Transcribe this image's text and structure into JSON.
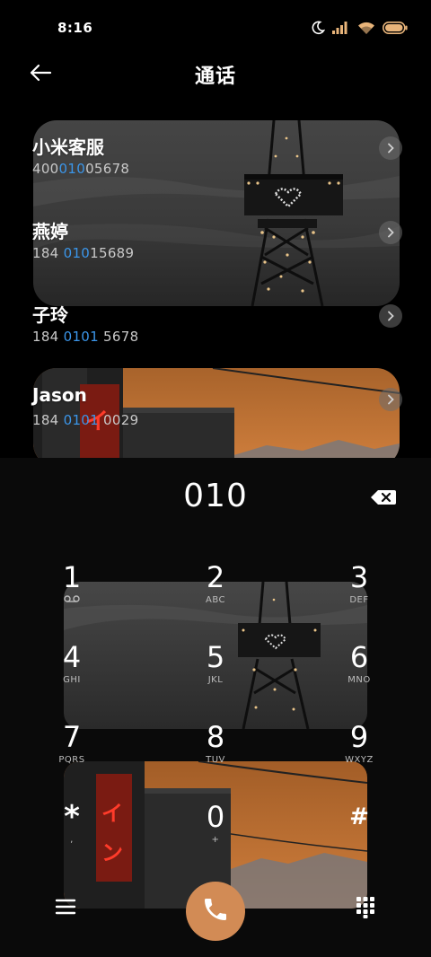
{
  "status_bar": {
    "time": "8:16",
    "icons": [
      "moon-icon",
      "signal-icon",
      "wifi-icon",
      "battery-icon"
    ],
    "battery_color": "#e8b47a"
  },
  "header": {
    "back_icon": "arrow-left-icon",
    "title": "通话"
  },
  "contacts": [
    {
      "name": "小米客服",
      "number_before": "400",
      "number_match": "010",
      "number_after": "05678"
    },
    {
      "name": "燕婷",
      "number_before": "184 ",
      "number_match": "010",
      "number_after": "15689"
    },
    {
      "name": "子玲",
      "number_before": "184 ",
      "number_match": "0101",
      "number_after": " 5678"
    },
    {
      "name": "Jason",
      "number_before": "184 ",
      "number_match": "0101",
      "number_after": " 0029"
    }
  ],
  "dialer": {
    "input_value": "010",
    "delete_icon": "backspace-icon",
    "keys": [
      {
        "digit": "1",
        "sub": "voicemail-icon"
      },
      {
        "digit": "2",
        "sub": "ABC"
      },
      {
        "digit": "3",
        "sub": "DEF"
      },
      {
        "digit": "4",
        "sub": "GHI"
      },
      {
        "digit": "5",
        "sub": "JKL"
      },
      {
        "digit": "6",
        "sub": "MNO"
      },
      {
        "digit": "7",
        "sub": "PQRS"
      },
      {
        "digit": "8",
        "sub": "TUV"
      },
      {
        "digit": "9",
        "sub": "WXYZ"
      },
      {
        "digit": "*",
        "sub": ","
      },
      {
        "digit": "0",
        "sub": "+"
      },
      {
        "digit": "#",
        "sub": ""
      }
    ],
    "menu_icon": "hamburger-menu-icon",
    "call_icon": "phone-icon",
    "pad_icon": "dialpad-icon"
  },
  "colors": {
    "background": "#000000",
    "highlight": "#3b95e8",
    "call_button": "#d28b55"
  }
}
